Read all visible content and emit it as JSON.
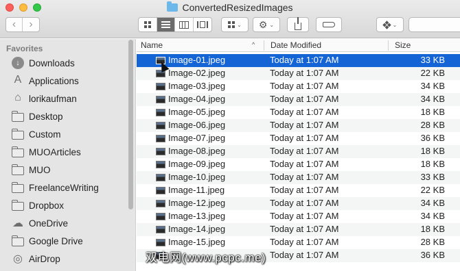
{
  "window": {
    "title": "ConvertedResizedImages"
  },
  "toolbar": {
    "back_glyph": "‹",
    "forward_glyph": "›",
    "view_modes": [
      "icon-view",
      "list-view",
      "column-view",
      "cover-flow-view"
    ],
    "active_view": "list-view",
    "arrange_chev": "⌄",
    "action_glyph": "⚙",
    "action_chev": "⌄",
    "dropbox_chev": "⌄"
  },
  "sidebar": {
    "heading": "Favorites",
    "items": [
      {
        "label": "Downloads",
        "icon": "downloads-icon",
        "glyph": "↓"
      },
      {
        "label": "Applications",
        "icon": "applications-icon",
        "glyph": "A"
      },
      {
        "label": "lorikaufman",
        "icon": "home-icon",
        "glyph": "⌂"
      },
      {
        "label": "Desktop",
        "icon": "folder-icon"
      },
      {
        "label": "Custom",
        "icon": "folder-icon"
      },
      {
        "label": "MUOArticles",
        "icon": "folder-icon"
      },
      {
        "label": "MUO",
        "icon": "folder-icon"
      },
      {
        "label": "FreelanceWriting",
        "icon": "folder-icon"
      },
      {
        "label": "Dropbox",
        "icon": "folder-icon"
      },
      {
        "label": "OneDrive",
        "icon": "cloud-icon",
        "glyph": "☁"
      },
      {
        "label": "Google Drive",
        "icon": "folder-icon"
      },
      {
        "label": "AirDrop",
        "icon": "airdrop-icon",
        "glyph": "◎"
      }
    ]
  },
  "list": {
    "columns": {
      "name": "Name",
      "date": "Date Modified",
      "size": "Size",
      "sort_glyph": "^"
    },
    "files": [
      {
        "name": "Image-01.jpeg",
        "date": "Today at 1:07 AM",
        "size": "33 KB"
      },
      {
        "name": "Image-02.jpeg",
        "date": "Today at 1:07 AM",
        "size": "22 KB"
      },
      {
        "name": "Image-03.jpeg",
        "date": "Today at 1:07 AM",
        "size": "34 KB"
      },
      {
        "name": "Image-04.jpeg",
        "date": "Today at 1:07 AM",
        "size": "34 KB"
      },
      {
        "name": "Image-05.jpeg",
        "date": "Today at 1:07 AM",
        "size": "18 KB"
      },
      {
        "name": "Image-06.jpeg",
        "date": "Today at 1:07 AM",
        "size": "28 KB"
      },
      {
        "name": "Image-07.jpeg",
        "date": "Today at 1:07 AM",
        "size": "36 KB"
      },
      {
        "name": "Image-08.jpeg",
        "date": "Today at 1:07 AM",
        "size": "18 KB"
      },
      {
        "name": "Image-09.jpeg",
        "date": "Today at 1:07 AM",
        "size": "18 KB"
      },
      {
        "name": "Image-10.jpeg",
        "date": "Today at 1:07 AM",
        "size": "33 KB"
      },
      {
        "name": "Image-11.jpeg",
        "date": "Today at 1:07 AM",
        "size": "22 KB"
      },
      {
        "name": "Image-12.jpeg",
        "date": "Today at 1:07 AM",
        "size": "34 KB"
      },
      {
        "name": "Image-13.jpeg",
        "date": "Today at 1:07 AM",
        "size": "34 KB"
      },
      {
        "name": "Image-14.jpeg",
        "date": "Today at 1:07 AM",
        "size": "18 KB"
      },
      {
        "name": "Image-15.jpeg",
        "date": "Today at 1:07 AM",
        "size": "28 KB"
      },
      {
        "name": "",
        "date": "Today at 1:07 AM",
        "size": "36 KB"
      }
    ],
    "selected": "Image-01.jpeg"
  },
  "watermark": "双电网(www.pcpc.me)",
  "colors": {
    "selection": "#1464d6",
    "sidebar_bg": "#e5e5e5",
    "folder_accent": "#6cb8ea"
  }
}
